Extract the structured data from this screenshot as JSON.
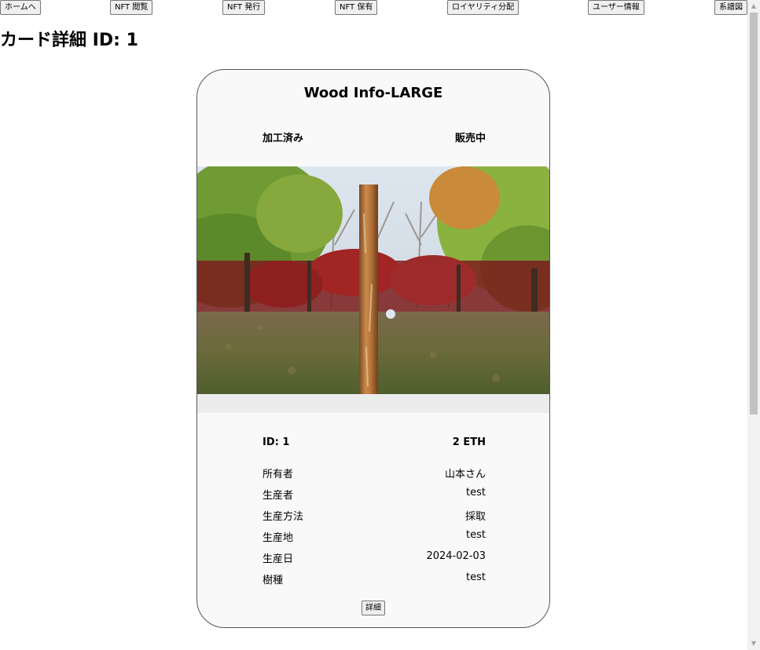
{
  "nav": {
    "home": "ホームへ",
    "nft_view": "NFT 閲覧",
    "nft_issue": "NFT 発行",
    "nft_owned": "NFT 保有",
    "royalty": "ロイヤリティ分配",
    "user_info": "ユーザー情報",
    "family_tree": "系譜図"
  },
  "page": {
    "title": "カード詳細 ID: 1"
  },
  "card": {
    "title": "Wood Info-LARGE",
    "status_left": "加工済み",
    "status_right": "販売中",
    "id_label": "ID: 1",
    "price": "2 ETH",
    "fields": [
      {
        "label": "所有者",
        "value": "山本さん"
      },
      {
        "label": "生産者",
        "value": "test"
      },
      {
        "label": "生産方法",
        "value": "採取"
      },
      {
        "label": "生産地",
        "value": "test"
      },
      {
        "label": "生産日",
        "value": "2024-02-03"
      },
      {
        "label": "樹種",
        "value": "test"
      }
    ],
    "detail_button": "詳細"
  }
}
